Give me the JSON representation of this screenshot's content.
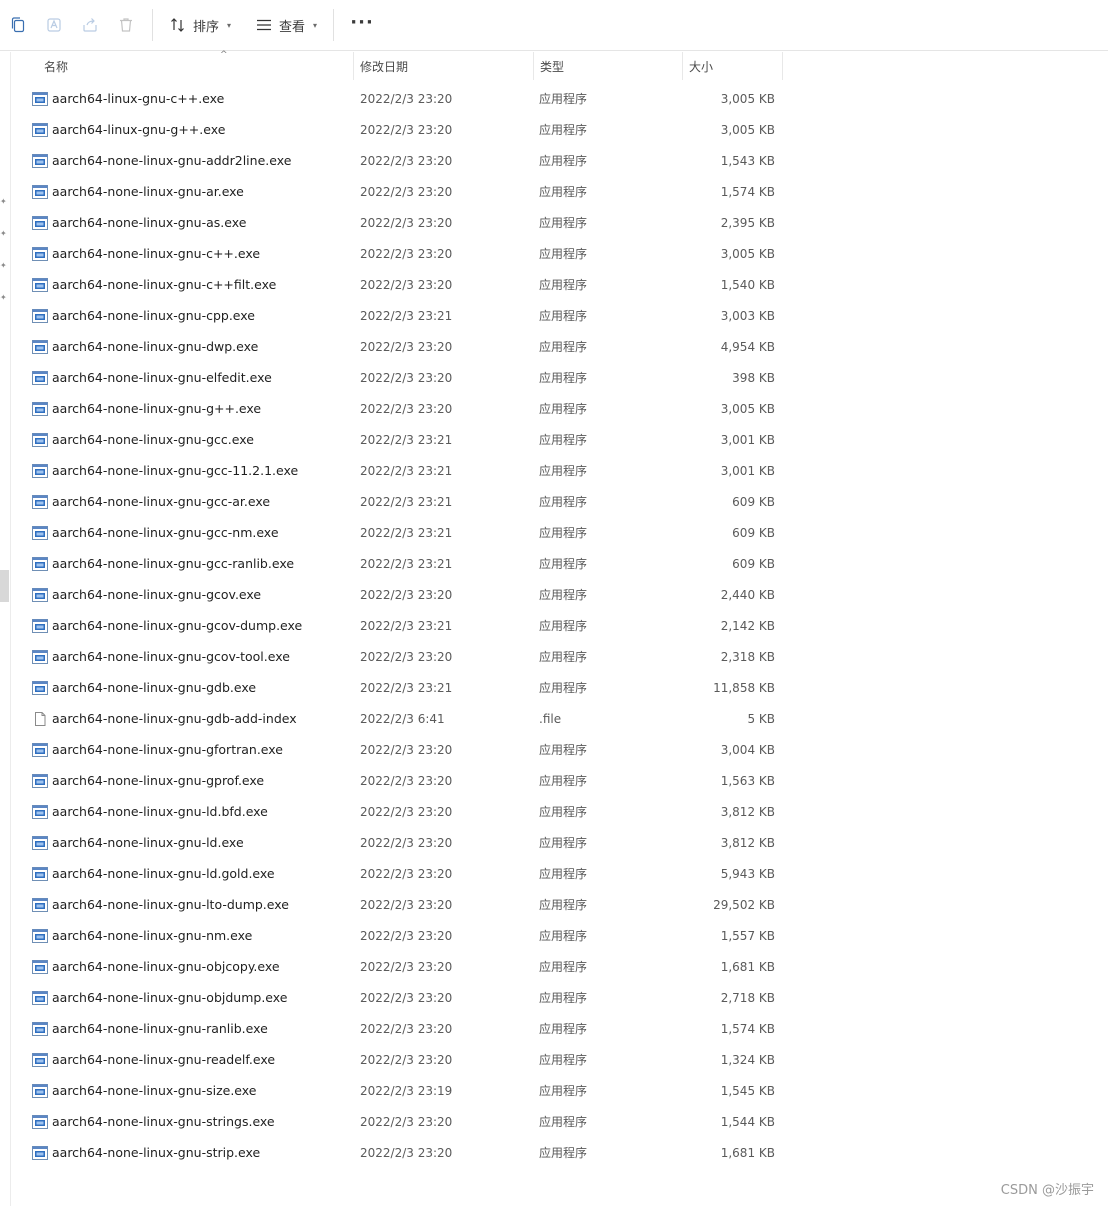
{
  "toolbar": {
    "sort_label": "排序",
    "view_label": "查看",
    "more_label": "···"
  },
  "columns": {
    "name": "名称",
    "date": "修改日期",
    "type": "类型",
    "size": "大小"
  },
  "files": [
    {
      "name": "aarch64-linux-gnu-c++.exe",
      "date": "2022/2/3 23:20",
      "type": "应用程序",
      "size": "3,005 KB",
      "icon": "exe"
    },
    {
      "name": "aarch64-linux-gnu-g++.exe",
      "date": "2022/2/3 23:20",
      "type": "应用程序",
      "size": "3,005 KB",
      "icon": "exe"
    },
    {
      "name": "aarch64-none-linux-gnu-addr2line.exe",
      "date": "2022/2/3 23:20",
      "type": "应用程序",
      "size": "1,543 KB",
      "icon": "exe"
    },
    {
      "name": "aarch64-none-linux-gnu-ar.exe",
      "date": "2022/2/3 23:20",
      "type": "应用程序",
      "size": "1,574 KB",
      "icon": "exe"
    },
    {
      "name": "aarch64-none-linux-gnu-as.exe",
      "date": "2022/2/3 23:20",
      "type": "应用程序",
      "size": "2,395 KB",
      "icon": "exe"
    },
    {
      "name": "aarch64-none-linux-gnu-c++.exe",
      "date": "2022/2/3 23:20",
      "type": "应用程序",
      "size": "3,005 KB",
      "icon": "exe"
    },
    {
      "name": "aarch64-none-linux-gnu-c++filt.exe",
      "date": "2022/2/3 23:20",
      "type": "应用程序",
      "size": "1,540 KB",
      "icon": "exe"
    },
    {
      "name": "aarch64-none-linux-gnu-cpp.exe",
      "date": "2022/2/3 23:21",
      "type": "应用程序",
      "size": "3,003 KB",
      "icon": "exe"
    },
    {
      "name": "aarch64-none-linux-gnu-dwp.exe",
      "date": "2022/2/3 23:20",
      "type": "应用程序",
      "size": "4,954 KB",
      "icon": "exe"
    },
    {
      "name": "aarch64-none-linux-gnu-elfedit.exe",
      "date": "2022/2/3 23:20",
      "type": "应用程序",
      "size": "398 KB",
      "icon": "exe"
    },
    {
      "name": "aarch64-none-linux-gnu-g++.exe",
      "date": "2022/2/3 23:20",
      "type": "应用程序",
      "size": "3,005 KB",
      "icon": "exe"
    },
    {
      "name": "aarch64-none-linux-gnu-gcc.exe",
      "date": "2022/2/3 23:21",
      "type": "应用程序",
      "size": "3,001 KB",
      "icon": "exe"
    },
    {
      "name": "aarch64-none-linux-gnu-gcc-11.2.1.exe",
      "date": "2022/2/3 23:21",
      "type": "应用程序",
      "size": "3,001 KB",
      "icon": "exe"
    },
    {
      "name": "aarch64-none-linux-gnu-gcc-ar.exe",
      "date": "2022/2/3 23:21",
      "type": "应用程序",
      "size": "609 KB",
      "icon": "exe"
    },
    {
      "name": "aarch64-none-linux-gnu-gcc-nm.exe",
      "date": "2022/2/3 23:21",
      "type": "应用程序",
      "size": "609 KB",
      "icon": "exe"
    },
    {
      "name": "aarch64-none-linux-gnu-gcc-ranlib.exe",
      "date": "2022/2/3 23:21",
      "type": "应用程序",
      "size": "609 KB",
      "icon": "exe"
    },
    {
      "name": "aarch64-none-linux-gnu-gcov.exe",
      "date": "2022/2/3 23:20",
      "type": "应用程序",
      "size": "2,440 KB",
      "icon": "exe"
    },
    {
      "name": "aarch64-none-linux-gnu-gcov-dump.exe",
      "date": "2022/2/3 23:21",
      "type": "应用程序",
      "size": "2,142 KB",
      "icon": "exe"
    },
    {
      "name": "aarch64-none-linux-gnu-gcov-tool.exe",
      "date": "2022/2/3 23:20",
      "type": "应用程序",
      "size": "2,318 KB",
      "icon": "exe"
    },
    {
      "name": "aarch64-none-linux-gnu-gdb.exe",
      "date": "2022/2/3 23:21",
      "type": "应用程序",
      "size": "11,858 KB",
      "icon": "exe"
    },
    {
      "name": "aarch64-none-linux-gnu-gdb-add-index",
      "date": "2022/2/3 6:41",
      "type": ".file",
      "size": "5 KB",
      "icon": "file"
    },
    {
      "name": "aarch64-none-linux-gnu-gfortran.exe",
      "date": "2022/2/3 23:20",
      "type": "应用程序",
      "size": "3,004 KB",
      "icon": "exe"
    },
    {
      "name": "aarch64-none-linux-gnu-gprof.exe",
      "date": "2022/2/3 23:20",
      "type": "应用程序",
      "size": "1,563 KB",
      "icon": "exe"
    },
    {
      "name": "aarch64-none-linux-gnu-ld.bfd.exe",
      "date": "2022/2/3 23:20",
      "type": "应用程序",
      "size": "3,812 KB",
      "icon": "exe"
    },
    {
      "name": "aarch64-none-linux-gnu-ld.exe",
      "date": "2022/2/3 23:20",
      "type": "应用程序",
      "size": "3,812 KB",
      "icon": "exe"
    },
    {
      "name": "aarch64-none-linux-gnu-ld.gold.exe",
      "date": "2022/2/3 23:20",
      "type": "应用程序",
      "size": "5,943 KB",
      "icon": "exe"
    },
    {
      "name": "aarch64-none-linux-gnu-lto-dump.exe",
      "date": "2022/2/3 23:20",
      "type": "应用程序",
      "size": "29,502 KB",
      "icon": "exe"
    },
    {
      "name": "aarch64-none-linux-gnu-nm.exe",
      "date": "2022/2/3 23:20",
      "type": "应用程序",
      "size": "1,557 KB",
      "icon": "exe"
    },
    {
      "name": "aarch64-none-linux-gnu-objcopy.exe",
      "date": "2022/2/3 23:20",
      "type": "应用程序",
      "size": "1,681 KB",
      "icon": "exe"
    },
    {
      "name": "aarch64-none-linux-gnu-objdump.exe",
      "date": "2022/2/3 23:20",
      "type": "应用程序",
      "size": "2,718 KB",
      "icon": "exe"
    },
    {
      "name": "aarch64-none-linux-gnu-ranlib.exe",
      "date": "2022/2/3 23:20",
      "type": "应用程序",
      "size": "1,574 KB",
      "icon": "exe"
    },
    {
      "name": "aarch64-none-linux-gnu-readelf.exe",
      "date": "2022/2/3 23:20",
      "type": "应用程序",
      "size": "1,324 KB",
      "icon": "exe"
    },
    {
      "name": "aarch64-none-linux-gnu-size.exe",
      "date": "2022/2/3 23:19",
      "type": "应用程序",
      "size": "1,545 KB",
      "icon": "exe"
    },
    {
      "name": "aarch64-none-linux-gnu-strings.exe",
      "date": "2022/2/3 23:20",
      "type": "应用程序",
      "size": "1,544 KB",
      "icon": "exe"
    },
    {
      "name": "aarch64-none-linux-gnu-strip.exe",
      "date": "2022/2/3 23:20",
      "type": "应用程序",
      "size": "1,681 KB",
      "icon": "exe"
    }
  ],
  "watermark": "CSDN @沙振宇",
  "colors": {
    "accent": "#1e6fbf",
    "exe_icon_frame": "#6f8fb5",
    "text_secondary": "#5a5a5a"
  }
}
